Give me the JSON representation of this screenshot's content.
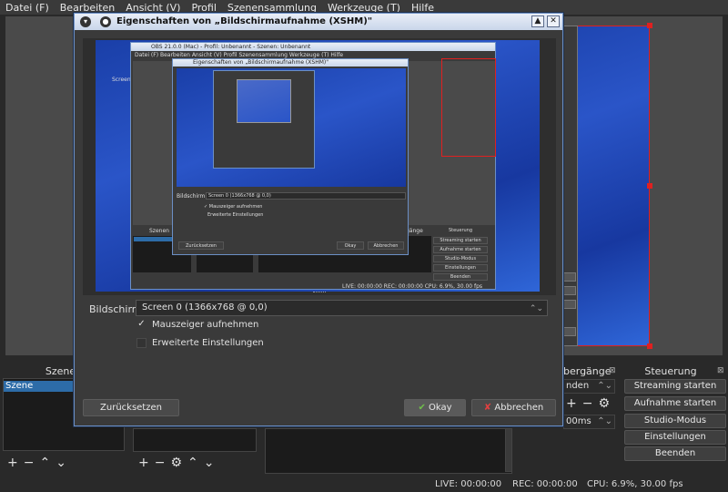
{
  "menubar": {
    "items": [
      "Datei (F)",
      "Bearbeiten",
      "Ansicht (V)",
      "Profil",
      "Szenensammlung",
      "Werkzeuge (T)",
      "Hilfe"
    ]
  },
  "docks": {
    "scenes_title": "Szenen",
    "scene_item": "Szene",
    "transitions_title": "bergänge",
    "transitions_select": "nden",
    "transition_duration": "00ms",
    "controls_title": "Steuerung"
  },
  "controls": {
    "buttons": [
      "Streaming starten",
      "Aufnahme starten",
      "Studio-Modus",
      "Einstellungen",
      "Beenden"
    ]
  },
  "status": {
    "live": "LIVE: 00:00:00",
    "rec": "REC: 00:00:00",
    "cpu": "CPU: 6.9%, 30.00 fps"
  },
  "dialog": {
    "title": "Eigenschaften von „Bildschirmaufnahme (XSHM)\"",
    "display_label": "Bildschirm",
    "display_value": "Screen 0 (1366x768 @ 0,0)",
    "capture_cursor_label": "Mauszeiger aufnehmen",
    "capture_cursor_checked": true,
    "advanced_label": "Erweiterte Einstellungen",
    "advanced_checked": false,
    "reset_button": "Zurücksetzen",
    "ok_button": "Okay",
    "cancel_button": "Abbrechen",
    "ok_icon": "ok-check-icon",
    "cancel_icon": "cancel-x-icon"
  },
  "nested_preview": {
    "title": "OBS 21.0.0 (Mac) - Profil: Unbenannt - Szenen: Unbenannt",
    "menu": "Datei (F)  Bearbeiten  Ansicht (V)  Profil  Szenensammlung  Werkzeuge (T)  Hilfe",
    "dialog_title": "Eigenschaften von „Bildschirmaufnahme (XSHM)\"",
    "display_label": "Bildschirm",
    "display_value": "Screen 0 (1366x768 @ 0,0)",
    "capture_cursor_label": "✓ Mauszeiger aufnehmen",
    "advanced_label": "Erweiterte Einstellungen",
    "reset_button": "Zurücksetzen",
    "ok_button": "Okay",
    "cancel_button": "Abbrechen",
    "desktop_icon_label": "Screen S",
    "controls": [
      "Steuerung",
      "Streaming starten",
      "Aufnahme starten",
      "Studio-Modus",
      "Einstellungen",
      "Beenden"
    ],
    "transitions_title": "gänge",
    "scenes_title": "Szenen",
    "status": "LIVE: 00:00:00      REC: 00:00:00      CPU: 6.9%, 30.00 fps"
  },
  "colors": {
    "accent_blue": "#2d6ca8",
    "selection_red": "#e02020",
    "dialog_border": "#6b8fc5"
  }
}
